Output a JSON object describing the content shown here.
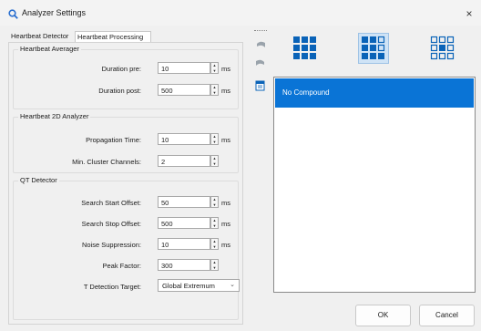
{
  "window": {
    "title": "Analyzer Settings",
    "close": "×"
  },
  "tabs": [
    {
      "label": "Heartbeat Detector",
      "selected": false
    },
    {
      "label": "Heartbeat Processing",
      "selected": true
    }
  ],
  "groups": {
    "averager": {
      "title": "Heartbeat Averager",
      "duration_pre": {
        "label": "Duration pre:",
        "value": "10",
        "unit": "ms"
      },
      "duration_post": {
        "label": "Duration post:",
        "value": "500",
        "unit": "ms"
      }
    },
    "analyzer2d": {
      "title": "Heartbeat 2D Analyzer",
      "propagation_time": {
        "label": "Propagation Time:",
        "value": "10",
        "unit": "ms"
      },
      "min_cluster_channels": {
        "label": "Min. Cluster Channels:",
        "value": "2"
      }
    },
    "qt": {
      "title": "QT Detector",
      "search_start": {
        "label": "Search Start Offset:",
        "value": "50",
        "unit": "ms"
      },
      "search_stop": {
        "label": "Search Stop Offset:",
        "value": "500",
        "unit": "ms"
      },
      "noise_suppression": {
        "label": "Noise Suppression:",
        "value": "10",
        "unit": "ms"
      },
      "peak_factor": {
        "label": "Peak Factor:",
        "value": "300"
      },
      "t_detection": {
        "label": "T Detection Target:",
        "value": "Global Extremum"
      }
    }
  },
  "compound_list": {
    "items": [
      "No Compound"
    ],
    "selected_index": 0
  },
  "view_modes": [
    "grid-all-icon",
    "grid-mixed-icon",
    "grid-center-icon"
  ],
  "view_mode_selected": 1,
  "buttons": {
    "ok": "OK",
    "cancel": "Cancel"
  },
  "colors": {
    "accent": "#0a74d6",
    "icon_blue": "#0a63b8",
    "selected_bg": "#cfe3f6"
  }
}
